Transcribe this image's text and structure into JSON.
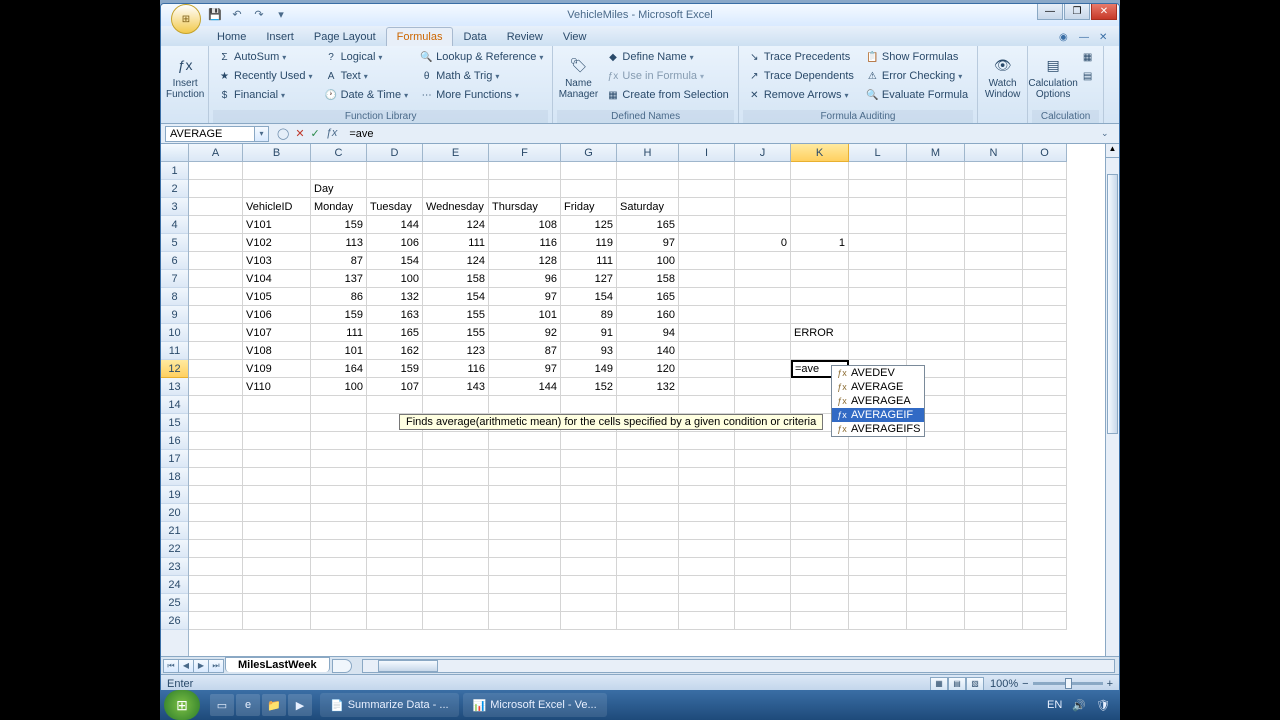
{
  "window": {
    "title": "VehicleMiles - Microsoft Excel"
  },
  "tabs": [
    "Home",
    "Insert",
    "Page Layout",
    "Formulas",
    "Data",
    "Review",
    "View"
  ],
  "active_tab": "Formulas",
  "ribbon": {
    "g1": {
      "label": "",
      "insert_function": "Insert\nFunction"
    },
    "g2": {
      "label": "Function Library",
      "autosum": "AutoSum",
      "recent": "Recently Used",
      "financial": "Financial",
      "logical": "Logical",
      "text": "Text",
      "datetime": "Date & Time",
      "lookup": "Lookup & Reference",
      "math": "Math & Trig",
      "more": "More Functions"
    },
    "g3": {
      "label": "Defined Names",
      "name_mgr": "Name\nManager",
      "define": "Define Name",
      "use": "Use in Formula",
      "create": "Create from Selection"
    },
    "g4": {
      "label": "Formula Auditing",
      "tprec": "Trace Precedents",
      "tdep": "Trace Dependents",
      "remarr": "Remove Arrows",
      "showf": "Show Formulas",
      "errchk": "Error Checking",
      "evalf": "Evaluate Formula"
    },
    "g5": {
      "label": "",
      "watch": "Watch\nWindow"
    },
    "g6": {
      "label": "Calculation",
      "opts": "Calculation\nOptions"
    }
  },
  "namebox": "AVERAGE",
  "formula_text": "=ave",
  "columns": [
    "A",
    "B",
    "C",
    "D",
    "E",
    "F",
    "G",
    "H",
    "I",
    "J",
    "K",
    "L",
    "M",
    "N",
    "O"
  ],
  "headers": {
    "day": "Day",
    "vehicle": "VehicleID",
    "mon": "Monday",
    "tue": "Tuesday",
    "wed": "Wednesday",
    "thu": "Thursday",
    "fri": "Friday",
    "sat": "Saturday"
  },
  "rows": [
    {
      "id": "V101",
      "v": [
        159,
        144,
        124,
        108,
        125,
        165
      ]
    },
    {
      "id": "V102",
      "v": [
        113,
        106,
        111,
        116,
        119,
        97
      ]
    },
    {
      "id": "V103",
      "v": [
        87,
        154,
        124,
        128,
        111,
        100
      ]
    },
    {
      "id": "V104",
      "v": [
        137,
        100,
        158,
        96,
        127,
        158
      ]
    },
    {
      "id": "V105",
      "v": [
        86,
        132,
        154,
        97,
        154,
        165
      ]
    },
    {
      "id": "V106",
      "v": [
        159,
        163,
        155,
        101,
        89,
        160
      ]
    },
    {
      "id": "V107",
      "v": [
        111,
        165,
        155,
        92,
        91,
        94
      ]
    },
    {
      "id": "V108",
      "v": [
        101,
        162,
        123,
        87,
        93,
        140
      ]
    },
    {
      "id": "V109",
      "v": [
        164,
        159,
        116,
        97,
        149,
        120
      ]
    },
    {
      "id": "V110",
      "v": [
        100,
        107,
        143,
        144,
        152,
        132
      ]
    }
  ],
  "j5": "0",
  "k5": "1",
  "k10": "ERROR",
  "editing_cell": "=ave",
  "autocomplete": [
    "AVEDEV",
    "AVERAGE",
    "AVERAGEA",
    "AVERAGEIF",
    "AVERAGEIFS"
  ],
  "autocomplete_selected": 3,
  "tooltip": "Finds average(arithmetic mean) for the cells specified by a given condition or criteria",
  "sheet_tab": "MilesLastWeek",
  "status": "Enter",
  "zoom": "100%",
  "task1": "Summarize Data - ...",
  "task2": "Microsoft Excel - Ve...",
  "tray_lang": "EN"
}
